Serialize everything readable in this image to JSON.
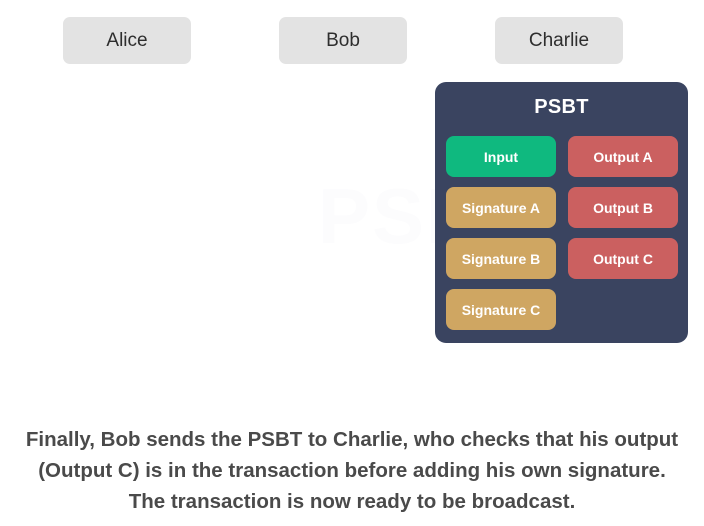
{
  "background_color": "#ffffff",
  "watermark": {
    "text": "PSBT"
  },
  "participants": [
    {
      "label": "Alice",
      "name": "alice"
    },
    {
      "label": "Bob",
      "name": "bob"
    },
    {
      "label": "Charlie",
      "name": "charlie"
    }
  ],
  "psbt_panel": {
    "title": "PSBT",
    "background_color": "#3a4460",
    "title_color": "#ffffff",
    "left_column": [
      {
        "label": "Input",
        "kind": "input",
        "color": "#0fb97f"
      },
      {
        "label": "Signature A",
        "kind": "signature",
        "color": "#cfa662"
      },
      {
        "label": "Signature B",
        "kind": "signature",
        "color": "#cfa662"
      },
      {
        "label": "Signature C",
        "kind": "signature",
        "color": "#cfa662"
      }
    ],
    "right_column": [
      {
        "label": "Output A",
        "kind": "output",
        "color": "#cb6060"
      },
      {
        "label": "Output B",
        "kind": "output",
        "color": "#cb6060"
      },
      {
        "label": "Output C",
        "kind": "output",
        "color": "#cb6060"
      }
    ]
  },
  "caption": {
    "text": "Finally, Bob sends the PSBT to Charlie, who checks that his output (Output C) is in the transaction before adding his own signature. The transaction is now ready to be broadcast.",
    "color": "#4a4a4a"
  }
}
